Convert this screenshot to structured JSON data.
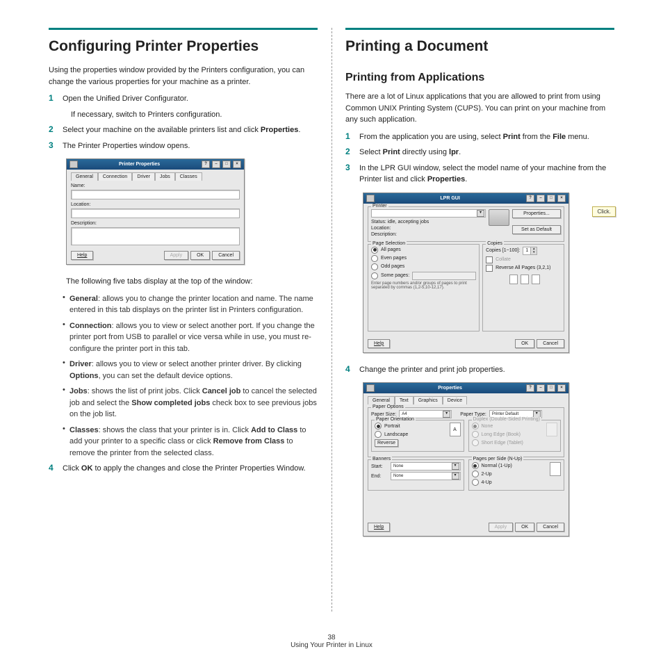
{
  "footer": {
    "page_num": "38",
    "caption": "Using Your Printer in Linux"
  },
  "left": {
    "h1": "Configuring Printer Properties",
    "intro": "Using the properties window provided by the Printers configuration, you can change the various properties for your machine as a printer.",
    "s1": "Open the Unified Driver Configurator.",
    "s1_sub": "If necessary, switch to Printers configuration.",
    "s2_a": "Select your machine on the available printers list and click ",
    "s2_b": "Properties",
    "s2_c": ".",
    "s3": "The Printer Properties window opens.",
    "tabs_intro": "The following five tabs display at the top of the window:",
    "bul1_t": "General",
    "bul1_b": ": allows you to change the printer location and name. The name entered in this tab displays on the printer list in Printers configuration.",
    "bul2_t": "Connection",
    "bul2_b": ": allows you to view or select another port. If you change the printer port from USB to parallel or vice versa while in use, you must re-configure the printer port in this tab.",
    "bul3_t": "Driver",
    "bul3_b1": ": allows you to view or select another printer driver. By clicking ",
    "bul3_b2": "Options",
    "bul3_b3": ", you can set the default device options.",
    "bul4_t": "Jobs",
    "bul4_b1": ": shows the list of print jobs. Click ",
    "bul4_b2": "Cancel job",
    "bul4_b3": " to cancel the selected job and select the ",
    "bul4_b4": "Show completed jobs",
    "bul4_b5": " check box to see previous jobs on the job list.",
    "bul5_t": "Classes",
    "bul5_b1": ": shows the class that your printer is in. Click ",
    "bul5_b2": "Add to Class",
    "bul5_b3": " to add your printer to a specific class or click ",
    "bul5_b4": "Remove from Class",
    "bul5_b5": " to remove the printer from the selected class.",
    "s4_a": "Click ",
    "s4_b": "OK",
    "s4_c": " to apply the changes and close the Printer Properties Window.",
    "win": {
      "title": "Printer Properties",
      "tabs": [
        "General",
        "Connection",
        "Driver",
        "Jobs",
        "Classes"
      ],
      "name_l": "Name:",
      "loc_l": "Location:",
      "desc_l": "Description:",
      "help": "Help",
      "apply": "Apply",
      "ok": "OK",
      "cancel": "Cancel"
    }
  },
  "right": {
    "h1": "Printing a Document",
    "h2": "Printing from Applications",
    "intro": "There are a lot of Linux applications that you are allowed to print from using Common UNIX Printing System (CUPS). You can print on your machine from any such application.",
    "s1_a": "From the application you are using, select ",
    "s1_b": "Print",
    "s1_c": " from the ",
    "s1_d": "File",
    "s1_e": " menu.",
    "s2_a": "Select ",
    "s2_b": "Print",
    "s2_c": " directly using ",
    "s2_d": "lpr",
    "s2_e": ".",
    "s3_a": "In the LPR GUI window, select the model name of your machine from the Printer list and click ",
    "s3_b": "Properties",
    "s3_c": ".",
    "callout": "Click.",
    "s4": "Change the printer and print job properties.",
    "lpr": {
      "title": "LPR GUI",
      "printer_l": "Printer",
      "status": "Status: idle, accepting jobs",
      "loc": "Location:",
      "desc": "Description:",
      "props": "Properties...",
      "setdef": "Set as Default",
      "pagesel_l": "Page Selection",
      "all": "All pages",
      "even": "Even pages",
      "odd": "Odd pages",
      "some": "Some pages:",
      "some_hint": "Enter page numbers and/or groups of pages to print separated by commas (1,2-5,10-12,17).",
      "copies_l": "Copies",
      "copies_n": "Copies [1~100]:",
      "copies_v": "1",
      "collate": "Collate",
      "reverse": "Reverse All Pages (3,2,1)",
      "help": "Help",
      "ok": "OK",
      "cancel": "Cancel"
    },
    "props": {
      "title": "Properties",
      "tabs": [
        "General",
        "Text",
        "Graphics",
        "Device"
      ],
      "paper_opt": "Paper Options",
      "size_l": "Paper Size:",
      "size_v": "A4",
      "type_l": "Paper Type:",
      "type_v": "Printer Default",
      "orient_l": "Paper Orientation",
      "portrait": "Portrait",
      "landscape": "Landscape",
      "reverse_btn": "Reverse",
      "duplex_l": "Duplex (Double-Sided Printing)",
      "d_none": "None",
      "d_long": "Long Edge (Book)",
      "d_short": "Short Edge (Tablet)",
      "banners_l": "Banners",
      "b_start": "Start:",
      "b_end": "End:",
      "b_none": "None",
      "pps_l": "Pages per Side (N-Up)",
      "p_normal": "Normal (1-Up)",
      "p_2": "2-Up",
      "p_4": "4-Up",
      "help": "Help",
      "apply": "Apply",
      "ok": "OK",
      "cancel": "Cancel"
    }
  }
}
